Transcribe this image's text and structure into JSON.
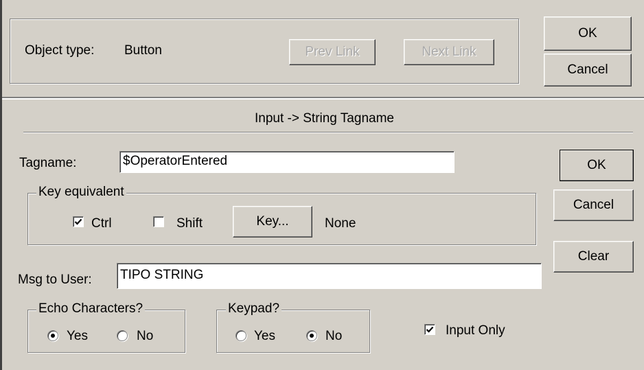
{
  "link_panel": {
    "object_type_label": "Object type:",
    "object_type_value": "Button",
    "prev_link": "Prev Link",
    "next_link": "Next Link",
    "ok": "OK",
    "cancel": "Cancel"
  },
  "dialog": {
    "title": "Input -> String Tagname",
    "tagname_label": "Tagname:",
    "tagname_value": "$OperatorEntered",
    "key_equivalent": {
      "legend": "Key equivalent",
      "ctrl_label": "Ctrl",
      "ctrl_checked": true,
      "shift_label": "Shift",
      "shift_checked": false,
      "key_button": "Key...",
      "key_value": "None"
    },
    "msg_label": "Msg to User:",
    "msg_value": "TIPO STRING",
    "echo": {
      "legend": "Echo Characters?",
      "yes": "Yes",
      "no": "No",
      "selected": "Yes"
    },
    "keypad": {
      "legend": "Keypad?",
      "yes": "Yes",
      "no": "No",
      "selected": "No"
    },
    "input_only_label": "Input Only",
    "input_only_checked": true,
    "ok": "OK",
    "cancel": "Cancel",
    "clear": "Clear"
  }
}
